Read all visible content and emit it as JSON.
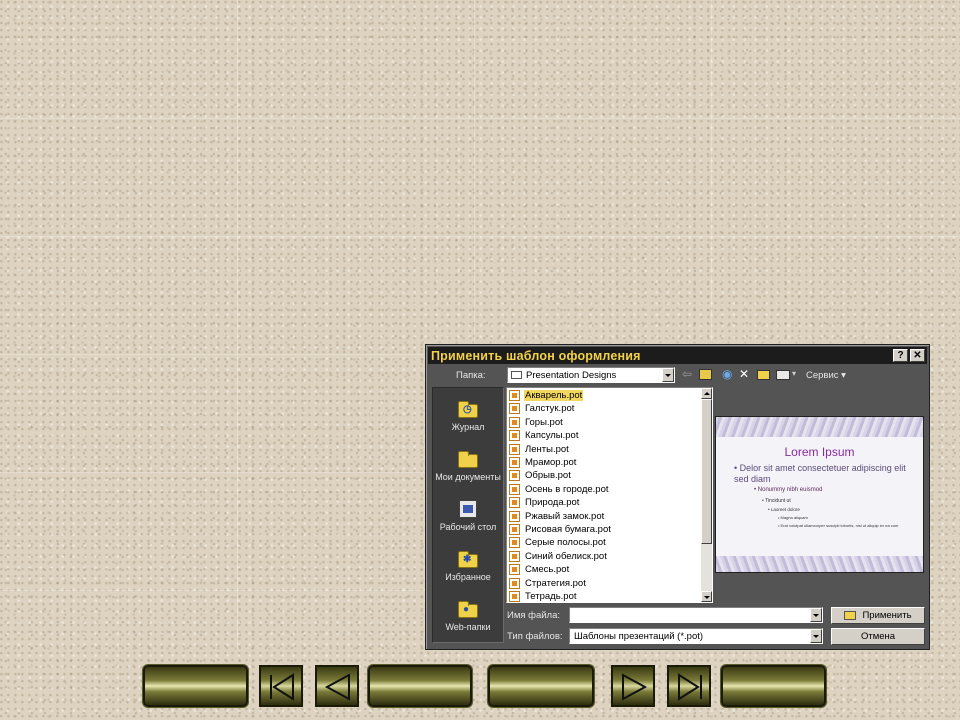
{
  "dialog": {
    "title": "Применить шаблон оформления",
    "help_button": "?",
    "close_button": "✕",
    "folder_label": "Папка:",
    "folder_value": "Presentation Designs",
    "service_label": "Сервис"
  },
  "places": [
    {
      "label": "Журнал",
      "icon": "history-icon"
    },
    {
      "label": "Мои документы",
      "icon": "my-documents-icon"
    },
    {
      "label": "Рабочий стол",
      "icon": "desktop-icon"
    },
    {
      "label": "Избранное",
      "icon": "favorites-icon"
    },
    {
      "label": "Web-папки",
      "icon": "web-folders-icon"
    }
  ],
  "files": [
    "Акварель.pot",
    "Галстук.pot",
    "Горы.pot",
    "Капсулы.pot",
    "Ленты.pot",
    "Мрамор.pot",
    "Обрыв.pot",
    "Осень в городе.pot",
    "Природа.pot",
    "Ржавый замок.pot",
    "Рисовая бумага.pot",
    "Серые полосы.pot",
    "Синий обелиск.pot",
    "Смесь.pot",
    "Стратегия.pot",
    "Тетрадь.pot"
  ],
  "selected_file": "Акварель.pot",
  "preview": {
    "title": "Lorem Ipsum",
    "bullet1": "Delor sit amet consectetuer adipiscing elit sed diam",
    "bullet2": "Nonummy nibh euismod",
    "bullet3": "Tincidunt ut",
    "bullet4": "Laoreet dolore",
    "bullet5": "Magna aliquam",
    "bullet6": "Erat volutpat ullamcorper suscipit lobortis, nisl ut aliquip ex ea com"
  },
  "filename_label": "Имя файла:",
  "filename_value": "",
  "filetype_label": "Тип файлов:",
  "filetype_value": "Шаблоны презентаций (*.pot)",
  "apply_button": "Применить",
  "cancel_button": "Отмена",
  "colors": {
    "title_text": "#f3d24a",
    "dialog_bg": "#545454",
    "selection": "#f2d760",
    "preview_title": "#8a2aa0"
  }
}
